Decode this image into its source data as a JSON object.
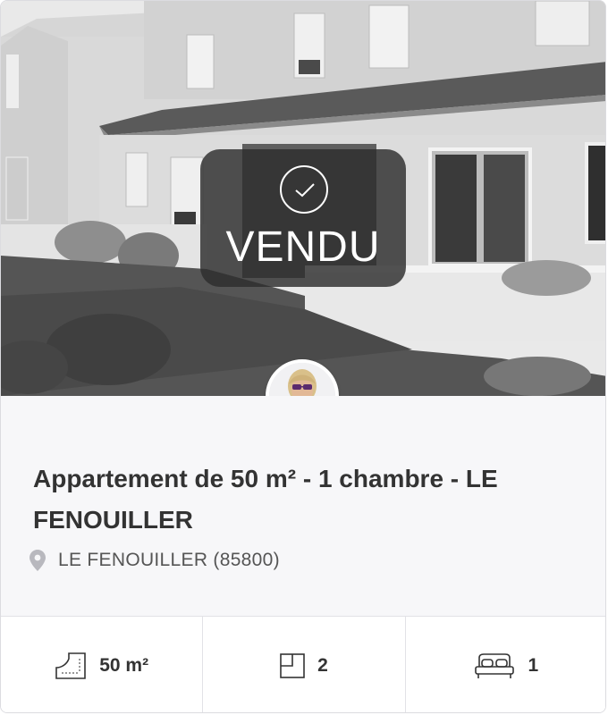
{
  "listing": {
    "status_label": "VENDU",
    "title": "Appartement de 50 m² - 1 chambre - LE FENOUILLER",
    "location": "LE FENOUILLER (85800)"
  },
  "features": {
    "surface": "50 m²",
    "rooms": "2",
    "bedrooms": "1"
  },
  "icons": {
    "sold": "check-circle-icon",
    "location": "map-pin-icon",
    "surface": "surface-area-icon",
    "rooms": "floor-plan-icon",
    "bedrooms": "bed-icon"
  }
}
